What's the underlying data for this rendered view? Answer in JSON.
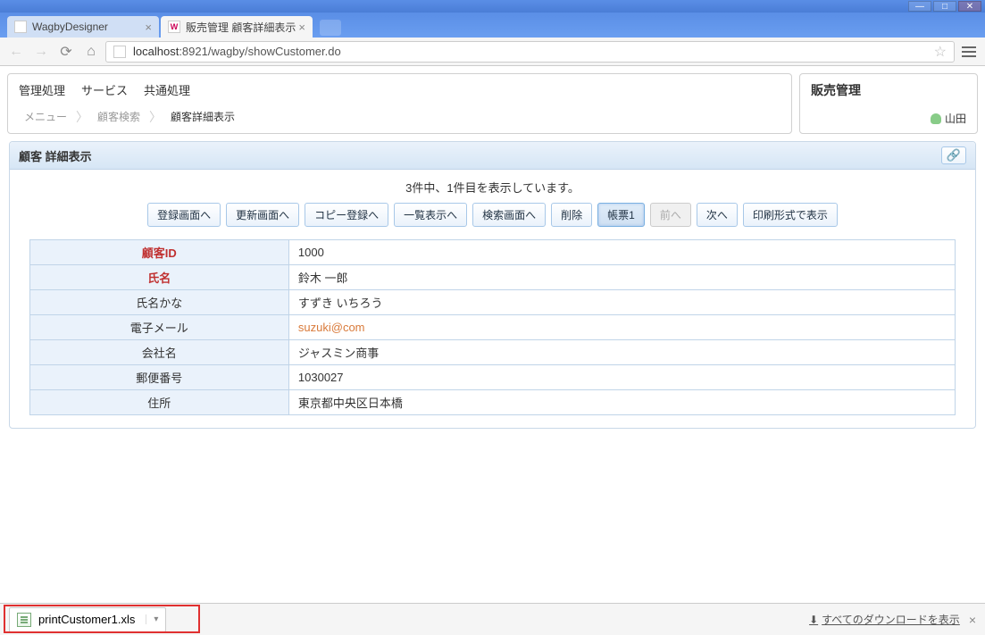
{
  "window": {
    "tabs": [
      {
        "title": "WagbyDesigner",
        "icon_letter": ""
      },
      {
        "title": "販売管理 顧客詳細表示",
        "icon_letter": "W"
      }
    ],
    "url_display_pre": "localhost",
    "url_display_post": ":8921/wagby/showCustomer.do"
  },
  "header": {
    "menu": {
      "admin": "管理処理",
      "service": "サービス",
      "common": "共通処理"
    },
    "breadcrumb": {
      "menu": "メニュー",
      "search": "顧客検索",
      "current": "顧客詳細表示"
    },
    "app_name": "販売管理",
    "user_name": "山田"
  },
  "panel": {
    "title": "顧客 詳細表示",
    "status": "3件中、1件目を表示しています。",
    "buttons": {
      "to_register": "登録画面へ",
      "to_update": "更新画面へ",
      "to_copy": "コピー登録へ",
      "to_list": "一覧表示へ",
      "to_search": "検索画面へ",
      "delete": "削除",
      "report1": "帳票1",
      "prev": "前へ",
      "next": "次へ",
      "print": "印刷形式で表示"
    },
    "fields": {
      "customer_id": {
        "label": "顧客ID",
        "value": "1000",
        "required": true
      },
      "name": {
        "label": "氏名",
        "value": "鈴木 一郎",
        "required": true
      },
      "name_kana": {
        "label": "氏名かな",
        "value": "すずき いちろう",
        "required": false
      },
      "email": {
        "label": "電子メール",
        "value": "suzuki@com",
        "required": false,
        "link": true
      },
      "company": {
        "label": "会社名",
        "value": "ジャスミン商事",
        "required": false
      },
      "postal": {
        "label": "郵便番号",
        "value": "1030027",
        "required": false
      },
      "address": {
        "label": "住所",
        "value": "東京都中央区日本橋",
        "required": false
      }
    }
  },
  "download": {
    "filename": "printCustomer1.xls",
    "show_all": "すべてのダウンロードを表示"
  }
}
